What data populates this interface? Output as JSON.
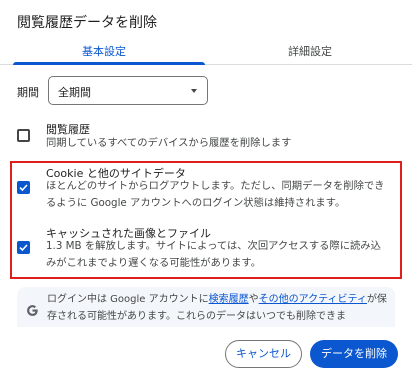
{
  "dialog": {
    "title": "閲覧履歴データを削除"
  },
  "tabs": [
    {
      "label": "基本設定",
      "active": true
    },
    {
      "label": "詳細設定",
      "active": false
    }
  ],
  "period": {
    "label": "期間",
    "selected": "全期間"
  },
  "options": [
    {
      "title": "閲覧履歴",
      "description": "同期しているすべてのデバイスから履歴を削除します",
      "checked": false
    },
    {
      "title": "Cookie と他のサイトデータ",
      "description": "ほとんどのサイトからログアウトします。ただし、同期データを削除できるように Google アカウントへのログイン状態は維持されます。",
      "checked": true
    },
    {
      "title": "キャッシュされた画像とファイル",
      "description": "1.3 MB を解放します。サイトによっては、次回アクセスする際に読み込みがこれまでより遅くなる可能性があります。",
      "checked": true
    }
  ],
  "info": {
    "text_before": "ログイン中は Google アカウントに",
    "link1": "検索履歴",
    "text_mid": "や",
    "link2": "その他のアクティビティ",
    "text_after": "が保存される可能性があります。これらのデータはいつでも削除できま"
  },
  "buttons": {
    "cancel": "キャンセル",
    "delete": "データを削除"
  },
  "colors": {
    "accent": "#0b57d0",
    "highlight": "#e01e1e",
    "info_bg": "#f3f6fb"
  },
  "icons": {
    "info": "google-g-icon",
    "dropdown": "triangle-down-icon",
    "check": "check-icon"
  }
}
